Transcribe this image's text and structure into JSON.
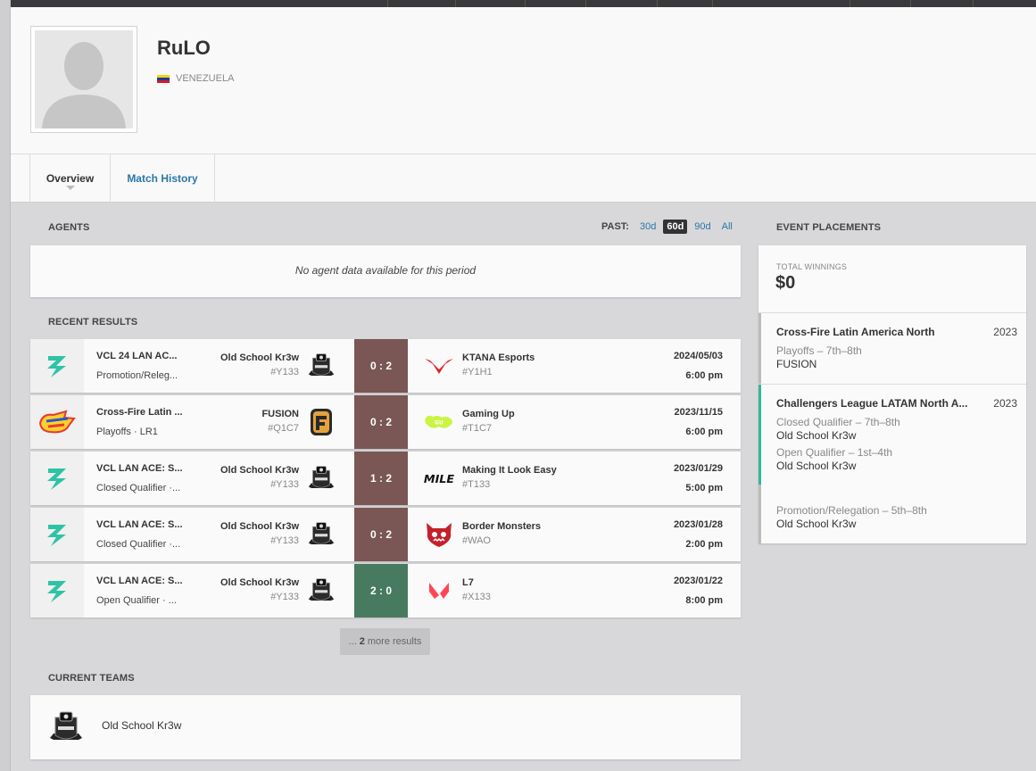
{
  "player": {
    "name": "RuLO",
    "country": "VENEZUELA",
    "flag_colors": [
      "#f7d116",
      "#1d3c92",
      "#d11a2a"
    ]
  },
  "tabs": [
    {
      "label": "Overview",
      "active": true
    },
    {
      "label": "Match History",
      "active": false
    }
  ],
  "agents": {
    "title": "AGENTS",
    "filter_label": "PAST:",
    "filter_options": [
      "30d",
      "60d",
      "90d",
      "All"
    ],
    "filter_selected": "60d",
    "empty_text": "No agent data available for this period"
  },
  "recent_results": {
    "title": "RECENT RESULTS",
    "matches": [
      {
        "event_icon": "lightning-bolt-icon",
        "event": "VCL 24 LAN AC...",
        "stage": "Promotion/Releg...",
        "team1": "Old School Kr3w",
        "team1_tag": "#Y133",
        "score": "0 : 2",
        "result": "loss",
        "team2": "KTANA Esports",
        "team2_tag": "#Y1H1",
        "date": "2024/05/03",
        "time": "6:00 pm"
      },
      {
        "event_icon": "crossfire-logo-icon",
        "event": "Cross-Fire Latin ...",
        "stage": "Playoffs · LR1",
        "team1": "FUSION",
        "team1_tag": "#Q1C7",
        "score": "0 : 2",
        "result": "loss",
        "team2": "Gaming Up",
        "team2_tag": "#T1C7",
        "date": "2023/11/15",
        "time": "6:00 pm"
      },
      {
        "event_icon": "lightning-bolt-icon",
        "event": "VCL LAN ACE: S...",
        "stage": "Closed Qualifier ·...",
        "team1": "Old School Kr3w",
        "team1_tag": "#Y133",
        "score": "1 : 2",
        "result": "loss",
        "team2": "Making It Look Easy",
        "team2_tag": "#T133",
        "date": "2023/01/29",
        "time": "5:00 pm"
      },
      {
        "event_icon": "lightning-bolt-icon",
        "event": "VCL LAN ACE: S...",
        "stage": "Closed Qualifier ·...",
        "team1": "Old School Kr3w",
        "team1_tag": "#Y133",
        "score": "0 : 2",
        "result": "loss",
        "team2": "Border Monsters",
        "team2_tag": "#WAO",
        "date": "2023/01/28",
        "time": "2:00 pm"
      },
      {
        "event_icon": "lightning-bolt-icon",
        "event": "VCL LAN ACE: S...",
        "stage": "Open Qualifier · ...",
        "team1": "Old School Kr3w",
        "team1_tag": "#Y133",
        "score": "2 : 0",
        "result": "win",
        "team2": "L7",
        "team2_tag": "#X133",
        "date": "2023/01/22",
        "time": "8:00 pm"
      }
    ],
    "more_prefix": "...",
    "more_count": "2",
    "more_suffix": "more results"
  },
  "current_teams": {
    "title": "CURRENT TEAMS",
    "teams": [
      {
        "name": "Old School Kr3w"
      }
    ]
  },
  "event_placements": {
    "title": "EVENT PLACEMENTS",
    "winnings_label": "TOTAL WINNINGS",
    "winnings": "$0",
    "events": [
      {
        "name": "Cross-Fire Latin America North",
        "year": "2023",
        "bar_color": "#bbbbbb",
        "lines": [
          {
            "stage": "Playoffs – 7th–8th",
            "team": "FUSION"
          }
        ]
      },
      {
        "name": "Challengers League LATAM North A...",
        "year": "2023",
        "bar_color": "#2fb79b",
        "lines": [
          {
            "stage": "Closed Qualifier – 7th–8th",
            "team": "Old School Kr3w"
          },
          {
            "stage": "Open Qualifier – 1st–4th",
            "team": "Old School Kr3w"
          }
        ]
      },
      {
        "name": "",
        "year": "",
        "bar_color": "#bbbbbb",
        "lines": [
          {
            "stage": "Promotion/Relegation – 5th–8th",
            "team": "Old School Kr3w"
          }
        ]
      }
    ]
  }
}
